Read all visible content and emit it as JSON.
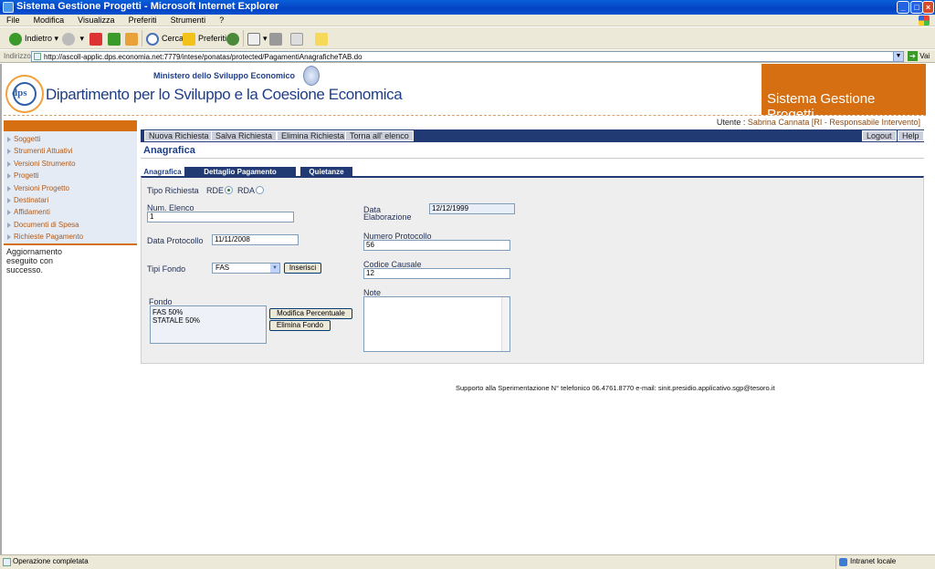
{
  "window": {
    "title": "Sistema Gestione Progetti - Microsoft Internet Explorer"
  },
  "menu": [
    "File",
    "Modifica",
    "Visualizza",
    "Preferiti",
    "Strumenti",
    "?"
  ],
  "toolbar": {
    "back": "Indietro",
    "search": "Cerca",
    "favorites": "Preferiti"
  },
  "address": {
    "label": "Indirizzo",
    "url": "http://ascoll-applic.dps.economia.net:7779/intese/ponatas/protected/PagamentiAnagraficheTAB.do",
    "go": "Vai"
  },
  "header": {
    "ministero": "Ministero dello Sviluppo Economico",
    "logo_text": "dps",
    "dipartimento": "Dipartimento per lo Sviluppo e la Coesione Economica",
    "system_name": "Sistema Gestione Progetti"
  },
  "user": {
    "label": "Utente :",
    "name": "Sabrina Cannata [RI - Responsabile Intervento]"
  },
  "sidebar": {
    "items": [
      "Soggetti",
      "Strumenti Attuativi",
      "Versioni Strumento",
      "Progetti",
      "Versioni Progetto",
      "Destinatari",
      "Affidamenti",
      "Documenti di Spesa",
      "Richieste Pagamento"
    ],
    "message": "Aggiornamento eseguito con successo."
  },
  "actions": {
    "nuova": "Nuova Richiesta",
    "salva": "Salva Richiesta",
    "elimina": "Elimina Richiesta",
    "torna": "Torna all' elenco",
    "logout": "Logout",
    "help": "Help"
  },
  "section_title": "Anagrafica",
  "tabs": [
    "Anagrafica",
    "Dettaglio Pagamento",
    "Quietanze"
  ],
  "form": {
    "tipo_richiesta_label": "Tipo Richiesta",
    "rde_label": "RDE",
    "rda_label": "RDA",
    "tipo_selected": "RDE",
    "num_elenco_label": "Num. Elenco",
    "num_elenco": "1",
    "data_elab_label_1": "Data",
    "data_elab_label_2": "Elaborazione",
    "data_elab": "12/12/1999",
    "data_protocollo_label": "Data Protocollo",
    "data_protocollo": "11/11/2008",
    "numero_protocollo_label": "Numero Protocollo",
    "numero_protocollo": "56",
    "tipi_fondo_label": "Tipi Fondo",
    "tipi_fondo_selected": "FAS",
    "inserisci": "Inserisci",
    "codice_causale_label": "Codice Causale",
    "codice_causale": "12",
    "fondo_label": "Fondo",
    "fondo_items": [
      "FAS 50%",
      "STATALE 50%"
    ],
    "modifica_percentuale": "Modifica Percentuale",
    "elimina_fondo": "Elimina Fondo",
    "note_label": "Note",
    "note": ""
  },
  "footer": "Supporto alla Sperimentazione N° telefonico 06.4761.8770 e-mail: sinit.presidio.applicativo.sgp@tesoro.it",
  "status": {
    "text": "Operazione completata",
    "zone": "Intranet locale"
  },
  "colors": {
    "accent_orange": "#d66f12",
    "navy": "#213a73",
    "title_blue": "#1f3e86"
  }
}
